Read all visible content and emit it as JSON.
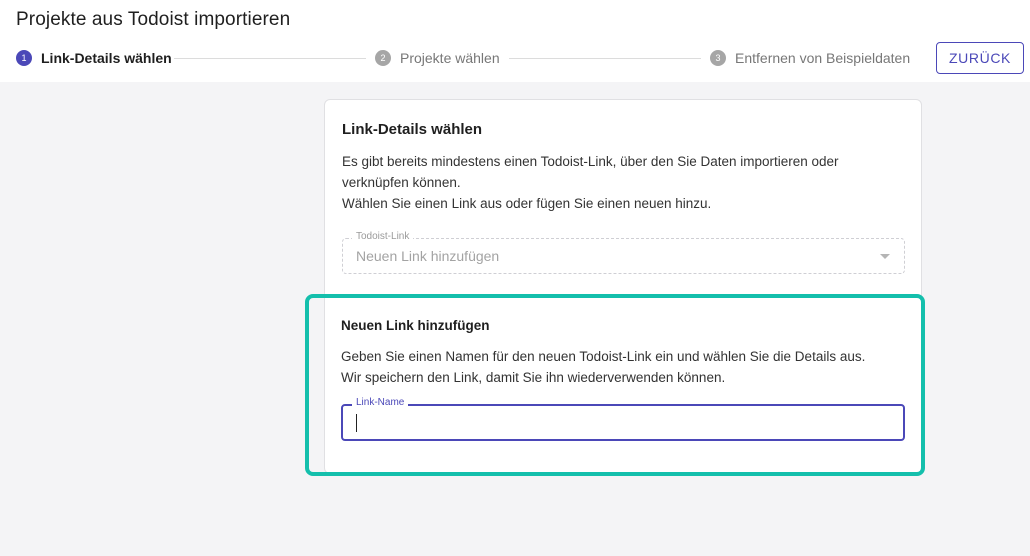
{
  "page": {
    "title": "Projekte aus Todoist importieren"
  },
  "stepper": {
    "steps": [
      {
        "number": "1",
        "label": "Link-Details wählen",
        "state": "active"
      },
      {
        "number": "2",
        "label": "Projekte wählen",
        "state": "inactive"
      },
      {
        "number": "3",
        "label": "Entfernen von Beispieldaten",
        "state": "inactive"
      }
    ],
    "back_label": "ZURÜCK"
  },
  "card": {
    "title": "Link-Details wählen",
    "description_line1": "Es gibt bereits mindestens einen Todoist-Link, über den Sie Daten importieren oder verknüpfen können.",
    "description_line2": "Wählen Sie einen Link aus oder fügen Sie einen neuen hinzu.",
    "select": {
      "label": "Todoist-Link",
      "value": "Neuen Link hinzufügen"
    }
  },
  "new_link": {
    "title": "Neuen Link hinzufügen",
    "description_line1": "Geben Sie einen Namen für den neuen Todoist-Link ein und wählen Sie die Details aus.",
    "description_line2": "Wir speichern den Link, damit Sie ihn wiederverwenden können.",
    "input": {
      "label": "Link-Name",
      "value": "",
      "placeholder": ""
    }
  },
  "colors": {
    "accent": "#4b48b8",
    "highlight": "#14bfac",
    "inactive_step": "#a6a6a6"
  },
  "icons": {
    "select_caret": "caret-down-icon"
  }
}
